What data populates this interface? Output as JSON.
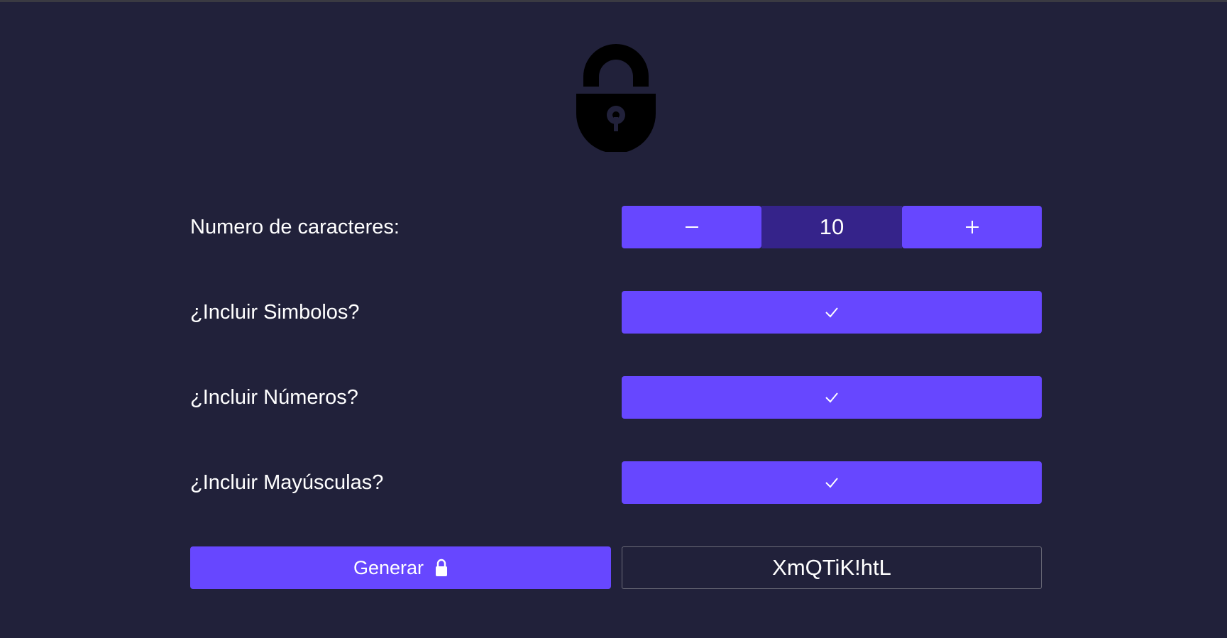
{
  "logo": {
    "icon": "padlock-icon"
  },
  "length": {
    "label": "Numero de caracteres:",
    "value": "10",
    "decrement_icon": "minus-icon",
    "increment_icon": "plus-icon"
  },
  "options": {
    "symbols": {
      "label": "¿Incluir Simbolos?",
      "checked": true,
      "icon": "check-icon"
    },
    "numbers": {
      "label": "¿Incluir Números?",
      "checked": true,
      "icon": "check-icon"
    },
    "uppercase": {
      "label": "¿Incluir Mayúsculas?",
      "checked": true,
      "icon": "check-icon"
    }
  },
  "generate": {
    "label": "Generar",
    "icon": "lock-icon"
  },
  "result": {
    "password": "XmQTiK!htL"
  },
  "colors": {
    "background": "#21213a",
    "accent": "#6747ff",
    "accent_dark": "#35238a",
    "text": "#ffffff"
  }
}
